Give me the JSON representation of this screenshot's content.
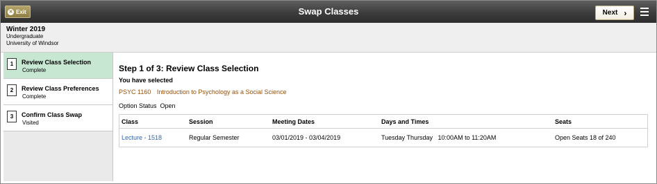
{
  "topbar": {
    "exit_label": "Exit",
    "title": "Swap Classes",
    "next_label": "Next"
  },
  "info": {
    "term": "Winter 2019",
    "career": "Undergraduate",
    "institution": "University of Windsor"
  },
  "steps": [
    {
      "number": "1",
      "name": "Review Class Selection",
      "status": "Complete"
    },
    {
      "number": "2",
      "name": "Review Class Preferences",
      "status": "Complete"
    },
    {
      "number": "3",
      "name": "Confirm Class Swap",
      "status": "Visited"
    }
  ],
  "main": {
    "step_title": "Step 1 of 3: Review Class Selection",
    "selected_label": "You have selected",
    "course_code": "PSYC 1160",
    "course_name": "Introduction to Psychology as a Social Science",
    "option_status": "Option Status  Open"
  },
  "table": {
    "headers": [
      "Class",
      "Session",
      "Meeting Dates",
      "Days and Times",
      "Seats"
    ],
    "rows": [
      {
        "class": "Lecture - 1518",
        "session": "Regular Semester",
        "meeting_dates": "03/01/2019 - 03/04/2019",
        "days_times": "Tuesday Thursday   10:00AM to 11:20AM",
        "seats": "Open Seats 18 of 240"
      }
    ]
  },
  "colors": {
    "active_step": "#c7e7d2",
    "course_link": "#9a4f07",
    "class_link": "#2e64b1",
    "exit_button": "#8f7f45"
  }
}
